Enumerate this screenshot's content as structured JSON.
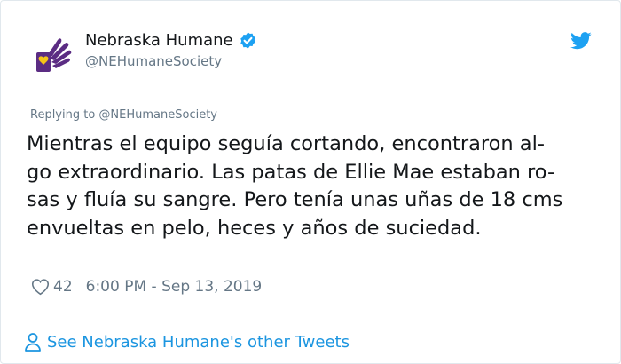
{
  "author": {
    "name": "Nebraska Humane",
    "handle": "@NEHumaneSociety",
    "verified": true
  },
  "replying_to": "Replying to @NEHumaneSociety",
  "tweet": {
    "lines": [
      "Mientras el equipo seguía cortando, encontraron al-",
      "go extraordinario. Las patas de Ellie Mae estaban ro-",
      "sas y fluía su sangre. Pero tenía unas uñas de 18 cms",
      "envueltas en pelo, heces y años de suciedad."
    ]
  },
  "stats": {
    "likes": "42",
    "timestamp": "6:00 PM - Sep 13, 2019"
  },
  "footer": {
    "link_text": "See Nebraska Humane's other Tweets"
  },
  "icons": {
    "avatar": "hand-heart-logo",
    "verified": "verified-badge-icon",
    "brand": "twitter-bird-icon",
    "like": "heart-icon",
    "profile": "person-icon"
  },
  "colors": {
    "accent": "#1b95e0",
    "text": "#14171a",
    "secondary": "#657786",
    "logo_purple": "#5b2c83",
    "logo_yellow": "#f5c518"
  }
}
